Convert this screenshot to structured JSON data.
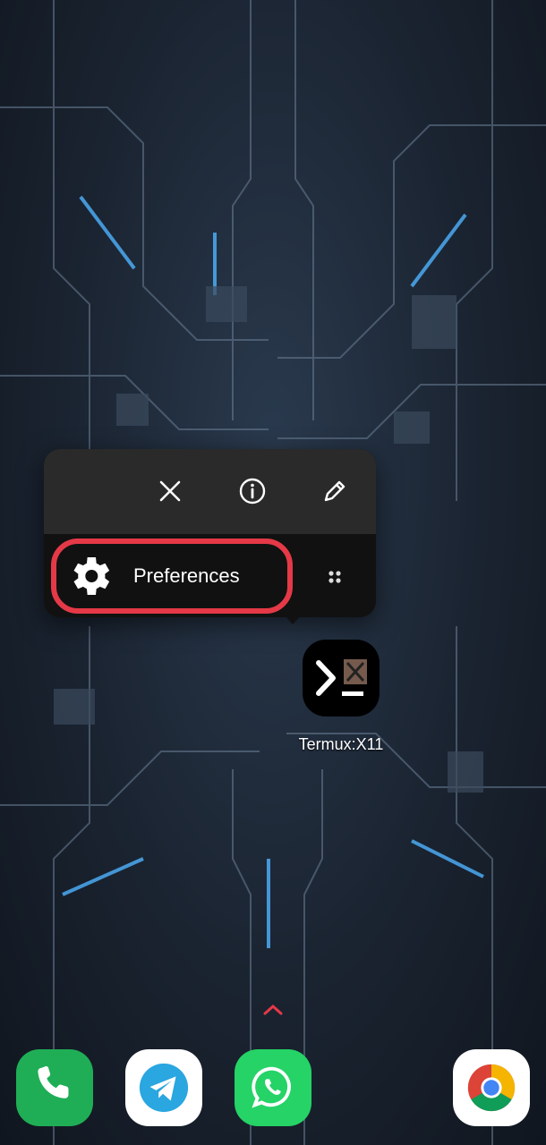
{
  "popup": {
    "actions": [
      {
        "name": "close",
        "icon": "close-icon"
      },
      {
        "name": "app-info",
        "icon": "info-icon"
      },
      {
        "name": "edit",
        "icon": "pencil-icon"
      }
    ],
    "shortcut": {
      "label": "Preferences",
      "icon": "gear-icon"
    },
    "highlight_color": "#e53947"
  },
  "app": {
    "label": "Termux:X11"
  },
  "dock": [
    {
      "name": "phone",
      "icon": "phone-icon",
      "color": "#1fae55"
    },
    {
      "name": "telegram",
      "icon": "telegram-icon",
      "color": "#ffffff"
    },
    {
      "name": "whatsapp",
      "icon": "whatsapp-icon",
      "color": "#25d366"
    },
    {
      "name": "chrome",
      "icon": "chrome-icon",
      "color": "#ffffff"
    }
  ]
}
